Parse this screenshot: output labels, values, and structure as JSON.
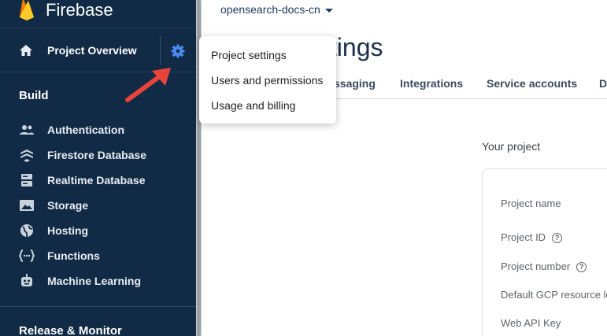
{
  "app": {
    "name": "Firebase"
  },
  "sidebar": {
    "project_overview": "Project Overview",
    "build_heading": "Build",
    "items": [
      {
        "label": "Authentication",
        "icon": "people-icon"
      },
      {
        "label": "Firestore Database",
        "icon": "firestore-icon"
      },
      {
        "label": "Realtime Database",
        "icon": "database-icon"
      },
      {
        "label": "Storage",
        "icon": "image-icon"
      },
      {
        "label": "Hosting",
        "icon": "globe-icon"
      },
      {
        "label": "Functions",
        "icon": "functions-icon"
      },
      {
        "label": "Machine Learning",
        "icon": "robot-icon"
      }
    ],
    "release_heading": "Release & Monitor"
  },
  "header": {
    "project": "opensearch-docs-cn",
    "title": "ttings"
  },
  "tabs": [
    "ssaging",
    "Integrations",
    "Service accounts",
    "D"
  ],
  "settings_menu": {
    "items": [
      "Project settings",
      "Users and permissions",
      "Usage and billing"
    ]
  },
  "main": {
    "your_project": "Your project",
    "fields": [
      "Project name",
      "Project ID",
      "Project number",
      "Default GCP resource lo",
      "Web API Key"
    ]
  },
  "colors": {
    "sidebar_bg": "#112a45",
    "accent": "#4a8df6",
    "arrow": "#e8443a"
  }
}
